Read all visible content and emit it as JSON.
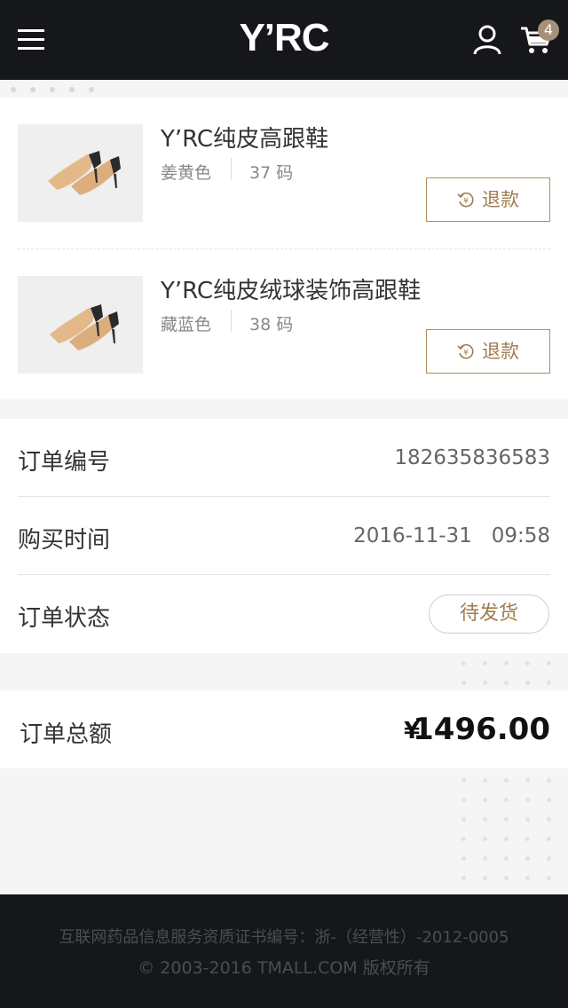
{
  "header": {
    "logo": "Y’RC",
    "cart_count": "4"
  },
  "products": [
    {
      "name": "Y’RC纯皮高跟鞋",
      "color": "姜黄色",
      "size": "37 码",
      "refund_label": "退款"
    },
    {
      "name": "Y’RC纯皮绒球装饰高跟鞋",
      "color": "藏蓝色",
      "size": "38 码",
      "refund_label": "退款"
    }
  ],
  "order": {
    "number_label": "订单编号",
    "number_value": "182635836583",
    "time_label": "购买时间",
    "time_value": "2016-11-31   09:58",
    "status_label": "订单状态",
    "status_value": "待发货"
  },
  "total": {
    "label": "订单总额",
    "currency": "¥",
    "value": "1496.00"
  },
  "footer": {
    "license": "互联网药品信息服务资质证书编号：浙-（经营性）-2012-0005",
    "copyright": "© 2003-2016 TMALL.COM 版权所有"
  },
  "colors": {
    "header_bg": "#15171b",
    "accent": "#a07c4e",
    "badge": "#a6907a"
  }
}
